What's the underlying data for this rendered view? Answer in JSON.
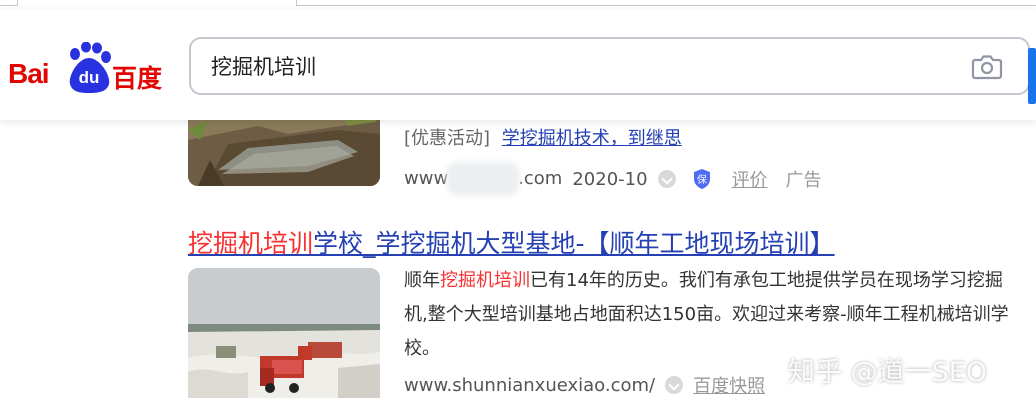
{
  "header": {
    "logo": {
      "latin": "Bai",
      "du": "du",
      "chinese": "百度"
    },
    "search": {
      "value": "挖掘机培训"
    },
    "icons": {
      "camera": "camera-icon"
    }
  },
  "results": [
    {
      "ad_tag": "[优惠活动]",
      "ad_link": "学挖掘机技术，到继思",
      "site_start": "www",
      "site_end": ".com",
      "date": "2020-10",
      "review_link": "评价",
      "ad_label": "广告"
    },
    {
      "title_red": "挖掘机培训",
      "title_rest": "学校_学挖掘机大型基地-【顺年工地现场培训】",
      "desc_pre": "顺年",
      "desc_red": "挖掘机培训",
      "desc_post": "已有14年的历史。我们有承包工地提供学员在现场学习挖掘机,整个大型培训基地占地面积达150亩。欢迎过来考察-顺年工程机械培训学校。",
      "url": "www.shunnianxuexiao.com/",
      "snapshot_link": "百度快照"
    }
  ],
  "watermark": "知乎 @道一SEO",
  "colors": {
    "brand_red": "#e10602",
    "brand_blue": "#2932e1",
    "link_blue": "#2440b3",
    "highlight_red": "#f73131"
  }
}
